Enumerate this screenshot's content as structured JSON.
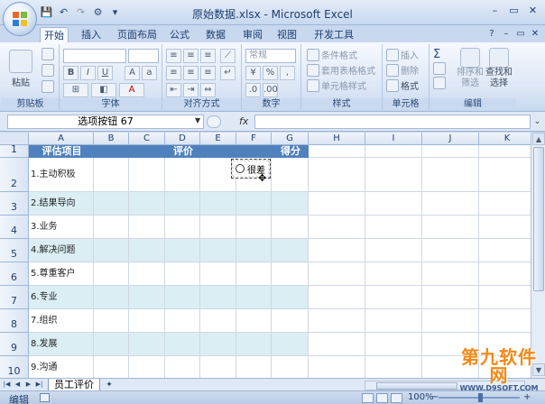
{
  "window": {
    "title": "原始数据.xlsx - Microsoft Excel",
    "controls": [
      "–",
      "▭",
      "✕"
    ]
  },
  "ribbon": {
    "tabs": [
      "开始",
      "插入",
      "页面布局",
      "公式",
      "数据",
      "审阅",
      "视图",
      "开发工具"
    ],
    "active_tab": "开始",
    "groups": {
      "clipboard": {
        "label": "剪贴板",
        "paste": "粘贴"
      },
      "font": {
        "label": "字体",
        "bold": "B",
        "italic": "I",
        "underline": "U",
        "font_color": "A"
      },
      "alignment": {
        "label": "对齐方式"
      },
      "number": {
        "label": "数字",
        "format_value": "常规",
        "percent": "%",
        "comma": ","
      },
      "styles": {
        "label": "样式",
        "conditional": "条件格式",
        "table": "套用表格格式",
        "cell_styles": "单元格样式"
      },
      "cells": {
        "label": "单元格",
        "insert": "插入",
        "delete": "删除",
        "format": "格式"
      },
      "editing": {
        "label": "编辑",
        "sort": "排序和",
        "filter": "筛选",
        "find": "查找和",
        "select": "选择"
      }
    }
  },
  "formula_bar": {
    "name_box": "选项按钮 67",
    "fx": "fx",
    "formula": ""
  },
  "sheet": {
    "columns": [
      "A",
      "B",
      "C",
      "D",
      "E",
      "F",
      "G",
      "H",
      "I",
      "J",
      "K"
    ],
    "row_numbers": [
      "1",
      "2",
      "3",
      "4",
      "5",
      "6",
      "7",
      "8",
      "9",
      "10"
    ],
    "header": {
      "a": "评估项目",
      "d": "评价",
      "g": "得分"
    },
    "items": [
      "1.主动积极",
      "2.结果导向",
      "3.业务",
      "4.解决问题",
      "5.尊重客户",
      "6.专业",
      "7.组织",
      "8.发展",
      "9.沟通"
    ],
    "option_button_label": "很差"
  },
  "sheet_tabs": {
    "active": "员工评价"
  },
  "status": {
    "mode": "编辑",
    "zoom": "100%"
  },
  "watermark": {
    "main": "第九软件网",
    "sub": "WWW.D9SOFT.COM"
  }
}
